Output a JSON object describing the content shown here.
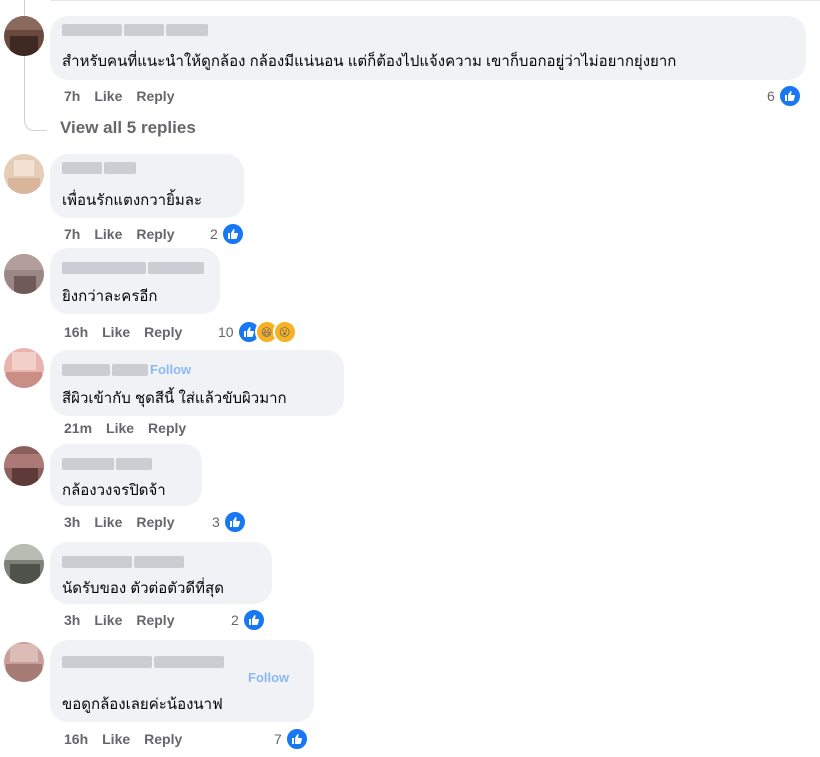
{
  "colors": {
    "accent": "#1877f2",
    "bubble": "#f0f2f5",
    "meta": "#65676b"
  },
  "thread": {
    "view_replies": "View all 5 replies"
  },
  "comments": [
    {
      "text": "สำหรับคนที่แนะนำให้ดูกล้อง กล้องมีแน่นอน แต่ก็ต้องไปแจ้งความ เขาก็บอกอยู่ว่าไม่อยากยุ่งยาก",
      "time": "7h",
      "like": "Like",
      "reply": "Reply",
      "reactions": "6"
    },
    {
      "text": "เพื่อนรักแตงกวายิ้มละ",
      "time": "7h",
      "like": "Like",
      "reply": "Reply",
      "reactions": "2"
    },
    {
      "text": "ยิงกว่าละครอีก",
      "time": "16h",
      "like": "Like",
      "reply": "Reply",
      "reactions": "10"
    },
    {
      "text": "สีผิวเข้ากับ ชุดสีนี้ ใส่แล้วขับผิวมาก",
      "time": "21m",
      "like": "Like",
      "reply": "Reply",
      "follow": "Follow"
    },
    {
      "text": "กล้องวงจรปิดจ้า",
      "time": "3h",
      "like": "Like",
      "reply": "Reply",
      "reactions": "3"
    },
    {
      "text": "นัดรับของ ตัวต่อตัวดีที่สุด",
      "time": "3h",
      "like": "Like",
      "reply": "Reply",
      "reactions": "2"
    },
    {
      "text": "ขอดูกล้องเลยค่ะน้องนาฟ",
      "time": "16h",
      "like": "Like",
      "reply": "Reply",
      "reactions": "7",
      "follow": "Follow"
    }
  ],
  "icons": {
    "like": "thumbs-up-icon",
    "haha": "laughing-face-icon",
    "wow": "surprised-face-icon"
  }
}
